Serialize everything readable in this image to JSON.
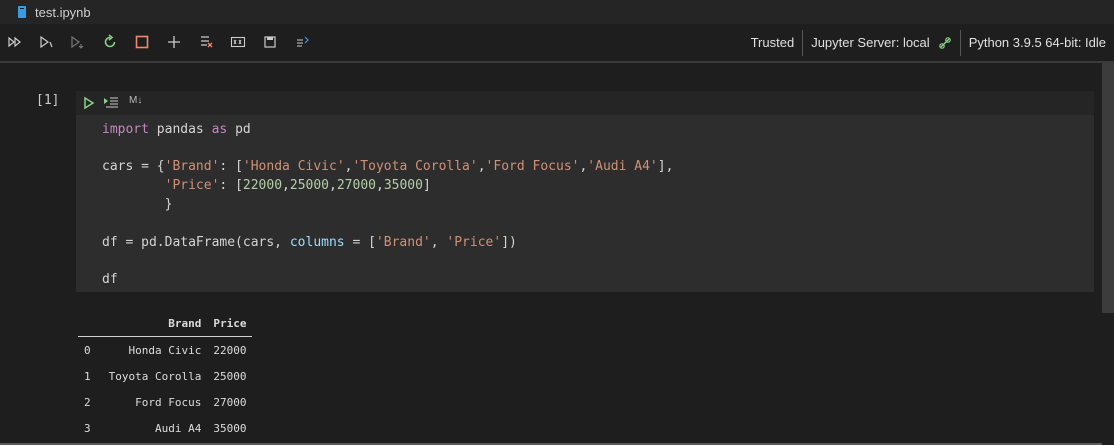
{
  "tab": {
    "title": "test.ipynb",
    "icon": "notebook-file-icon"
  },
  "toolbar": {
    "buttons": [
      "run-all-icon",
      "run-above-icon",
      "run-below-icon",
      "restart-icon",
      "interrupt-icon",
      "add-cell-icon",
      "clear-outputs-icon",
      "variables-icon",
      "save-icon",
      "export-icon"
    ]
  },
  "status": {
    "trusted": "Trusted",
    "server": "Jupyter Server: local",
    "kernel": "Python 3.9.5 64-bit: Idle"
  },
  "cell": {
    "execution_count": "[1]",
    "cell_type_label": "M↓",
    "code": {
      "line1": {
        "kw1": "import",
        "mod": " pandas ",
        "kw2": "as",
        "alias": " pd"
      },
      "line3": {
        "a": "cars = {",
        "s1": "'Brand'",
        "b": ": [",
        "s2": "'Honda Civic'",
        "c1": ",",
        "s3": "'Toyota Corolla'",
        "c2": ",",
        "s4": "'Ford Focus'",
        "c3": ",",
        "s5": "'Audi A4'",
        "d": "],"
      },
      "line4": {
        "indent": "        ",
        "s1": "'Price'",
        "b": ": [",
        "n1": "22000",
        "c1": ",",
        "n2": "25000",
        "c2": ",",
        "n3": "27000",
        "c3": ",",
        "n4": "35000",
        "d": "]"
      },
      "line5": "        }",
      "line7": {
        "a": "df = pd.DataFrame(cars, ",
        "par": "columns",
        "b": " = [",
        "s1": "'Brand'",
        "c": ", ",
        "s2": "'Price'",
        "d": "])"
      },
      "line9": "df"
    }
  },
  "output": {
    "columns": [
      "",
      "Brand",
      "Price"
    ],
    "rows": [
      [
        "0",
        "Honda Civic",
        "22000"
      ],
      [
        "1",
        "Toyota Corolla",
        "25000"
      ],
      [
        "2",
        "Ford Focus",
        "27000"
      ],
      [
        "3",
        "Audi A4",
        "35000"
      ]
    ]
  },
  "colors": {
    "keyword": "#c586c0",
    "string": "#ce9178",
    "number": "#b5cea8",
    "parameter": "#9cdcfe",
    "run_green": "#89d185",
    "interrupt_red": "#f48771",
    "restart_green": "#89d185"
  }
}
